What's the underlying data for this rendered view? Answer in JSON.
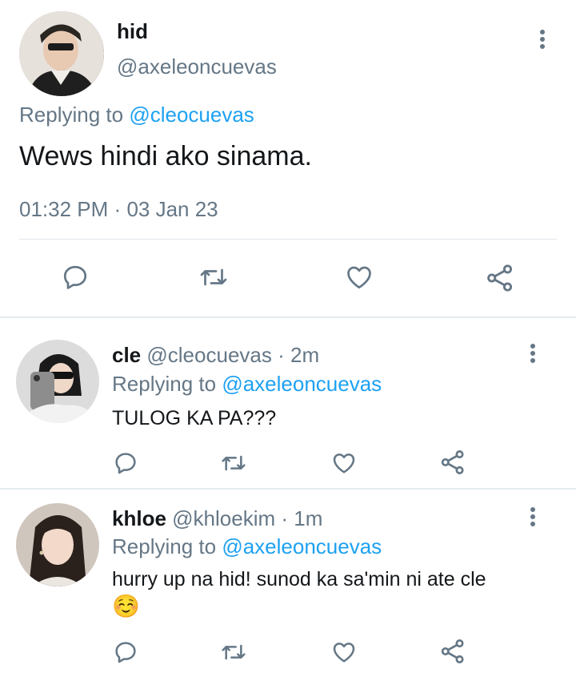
{
  "main_tweet": {
    "display_name": "hid",
    "handle": "@axeleoncuevas",
    "replying_prefix": "Replying to",
    "replying_to": "@cleocuevas",
    "text": "Wews hindi ako sinama.",
    "time": "01:32 PM",
    "separator": "·",
    "date": "03 Jan 23"
  },
  "replies": [
    {
      "display_name": "cle",
      "handle": "@cleocuevas",
      "age": "· 2m",
      "replying_prefix": "Replying to",
      "replying_to": "@axeleoncuevas",
      "text": "TULOG KA PA???"
    },
    {
      "display_name": "khloe",
      "handle": "@khloekim",
      "age": "· 1m",
      "replying_prefix": "Replying to",
      "replying_to": "@axeleoncuevas",
      "text": "hurry up na hid! sunod ka sa'min ni ate cle",
      "emoji": "☺️"
    }
  ],
  "colors": {
    "accent": "#1da1f2",
    "secondary_text": "#657786",
    "icon": "#657786",
    "divider": "#e1e8ed"
  },
  "icons": [
    "more-vertical-icon",
    "reply-icon",
    "retweet-icon",
    "like-icon",
    "share-icon"
  ]
}
